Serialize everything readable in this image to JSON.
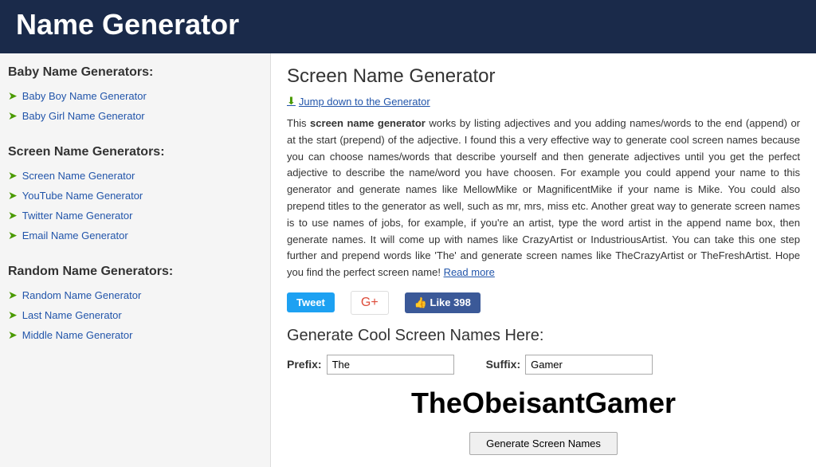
{
  "header": {
    "title": "Name Generator"
  },
  "sidebar": {
    "sections": [
      {
        "title": "Baby Name Generators:",
        "items": [
          {
            "label": "Baby Boy Name Generator"
          },
          {
            "label": "Baby Girl Name Generator"
          }
        ]
      },
      {
        "title": "Screen Name Generators:",
        "items": [
          {
            "label": "Screen Name Generator"
          },
          {
            "label": "YouTube Name Generator"
          },
          {
            "label": "Twitter Name Generator"
          },
          {
            "label": "Email Name Generator"
          }
        ]
      },
      {
        "title": "Random Name Generators:",
        "items": [
          {
            "label": "Random Name Generator"
          },
          {
            "label": "Last Name Generator"
          },
          {
            "label": "Middle Name Generator"
          }
        ]
      }
    ]
  },
  "content": {
    "page_title": "Screen Name Generator",
    "jump_link": "Jump down to the Generator",
    "description": "This screen name generator works by listing adjectives and you adding names/words to the end (append) or at the start (prepend) of the adjective. I found this a very effective way to generate cool screen names because you can choose names/words that describe yourself and then generate adjectives until you get the perfect adjective to describe the name/word you have choosen. For example you could append your name to this generator and generate names like MellowMike or MagnificentMike if your name is Mike. You could also prepend titles to the generator as well, such as mr, mrs, miss etc. Another great way to generate screen names is to use names of jobs, for example, if you're an artist, type the word artist in the append name box, then generate names. It will come up with names like CrazyArtist or IndustriousArtist. You can take this one step further and prepend words like 'The' and generate screen names like TheCrazyArtist or TheFreshArtist. Hope you find the perfect screen name!",
    "read_more": "Read more",
    "social": {
      "tweet_label": "Tweet",
      "gplus_label": "G+",
      "like_label": "Like 398"
    },
    "generator_title": "Generate Cool Screen Names Here:",
    "prefix_label": "Prefix:",
    "prefix_value": "The",
    "suffix_label": "Suffix:",
    "suffix_value": "Gamer",
    "generated_name": "TheObeisantGamer",
    "generate_button": "Generate Screen Names"
  }
}
